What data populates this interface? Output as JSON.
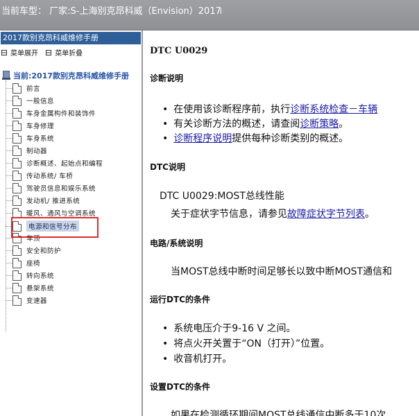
{
  "topbar": {
    "vehicle": "当前车型：  厂家:S-上海别克昂科威（Envision）2017"
  },
  "left": {
    "manual_title": "2017款别克昂科威维修手册",
    "expand_all": "菜单展开",
    "collapse_all": "菜单折叠",
    "root_label": "当前:2017款别克昂科威维修手册",
    "items": [
      {
        "label": "前言"
      },
      {
        "label": "一般信息"
      },
      {
        "label": "车身金属构件和装饰件"
      },
      {
        "label": "车身修理"
      },
      {
        "label": "车身系统"
      },
      {
        "label": "制动器"
      },
      {
        "label": "诊断概述、起始点和编程"
      },
      {
        "label": "传动系统/ 车桥"
      },
      {
        "label": "驾驶员信息和娱乐系统"
      },
      {
        "label": "发动机/ 推进系统"
      },
      {
        "label": "暖风、通风与空调系统"
      },
      {
        "label": "电源和信号分布"
      },
      {
        "label": "车顶"
      },
      {
        "label": "安全和防护"
      },
      {
        "label": "座椅"
      },
      {
        "label": "转向系统"
      },
      {
        "label": "悬架系统"
      },
      {
        "label": "变速器"
      }
    ]
  },
  "content": {
    "dtc_title": "DTC U0029",
    "diag_header": "诊断说明",
    "diag_bullets": [
      {
        "pre": "在使用该诊断程序前，执行",
        "link": "诊断系统检查－车辆",
        "post": ""
      },
      {
        "pre": "有关诊断方法的概述，请查阅",
        "link": "诊断策略",
        "post": "。"
      },
      {
        "pre": "",
        "link": "诊断程序说明",
        "post": "提供每种诊断类别的概述。"
      }
    ],
    "dtc_desc_header": "DTC说明",
    "dtc_desc": "DTC U0029:MOST总线性能",
    "symptom_pre": "关于症状字节信息，请参见",
    "symptom_link": "故障症状字节列表",
    "symptom_post": "。",
    "circuit_header": "电路/系统说明",
    "circuit_text": "当MOST总线中断时间足够长以致中断MOST通信和",
    "run_header": "运行DTC的条件",
    "run_bullets": [
      "系统电压介于9-16 V 之间。",
      "将点火开关置于“ON（打开）”位置。",
      "收音机打开。"
    ],
    "set_header": "设置DTC的条件",
    "set_text": "如果在检测循环期间MOST总线通信中断多于10次"
  }
}
